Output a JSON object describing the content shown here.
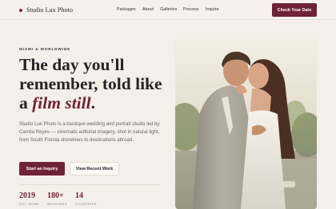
{
  "header": {
    "brand": "Studio Lux Photo",
    "nav": [
      "Packages",
      "About",
      "Galleries",
      "Process",
      "Inquire"
    ],
    "cta": "Check Your Date"
  },
  "hero": {
    "eyebrow": "MIAMI & WORLDWIDE",
    "headline_line1": "The day you'll",
    "headline_line2": "remember, told like",
    "headline_prefix": "a ",
    "headline_emphasis": "film still",
    "headline_suffix": ".",
    "description": "Studio Lux Photo is a boutique wedding and portrait studio led by Camila Reyes — cinematic editorial imagery, shot in natural light, from South Florida shorelines to destinations abroad.",
    "primary_button": "Start an Inquiry",
    "secondary_button": "View Recent Work"
  },
  "stats": [
    {
      "value": "2019",
      "label": "EST. MIAMI"
    },
    {
      "value": "180+",
      "label": "WEDDINGS"
    },
    {
      "value": "14",
      "label": "COUNTRIES"
    }
  ],
  "colors": {
    "accent": "#6e2434",
    "background": "#f4efe9"
  }
}
